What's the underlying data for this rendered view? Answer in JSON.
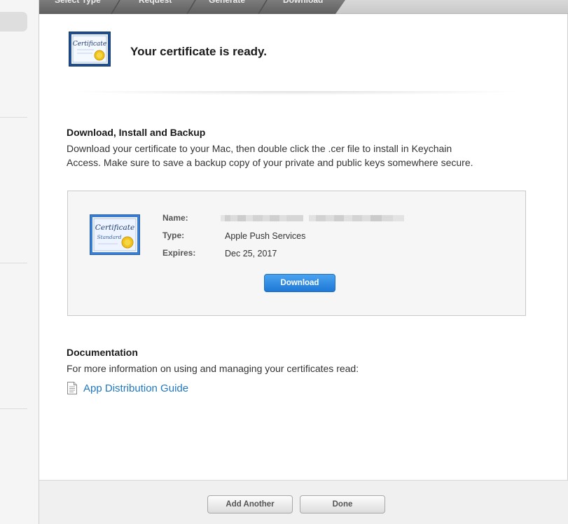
{
  "steps": [
    {
      "label": "Select Type"
    },
    {
      "label": "Request"
    },
    {
      "label": "Generate"
    },
    {
      "label": "Download"
    }
  ],
  "header": {
    "title": "Your certificate is ready.",
    "icon": "certificate-icon"
  },
  "download_section": {
    "heading": "Download, Install and Backup",
    "text_line1": "Download your certificate to your Mac, then double click the .cer file to install in Keychain",
    "text_line2": "Access. Make sure to save a backup copy of your private and public keys somewhere secure."
  },
  "certificate": {
    "icon": "certificate-standard-icon",
    "icon_title": "Certificate",
    "icon_subtitle": "Standard",
    "name_label": "Name:",
    "name_value": "",
    "type_label": "Type:",
    "type_value": "Apple Push Services",
    "expires_label": "Expires:",
    "expires_value": "Dec 25, 2017",
    "download_label": "Download"
  },
  "documentation": {
    "heading": "Documentation",
    "text": "For more information on using and managing your certificates read:",
    "link_label": "App Distribution Guide",
    "link_icon": "document-icon"
  },
  "footer": {
    "add_another_label": "Add Another",
    "done_label": "Done"
  },
  "colors": {
    "accent": "#1f78c1",
    "primary_button": "#2a86e0"
  }
}
